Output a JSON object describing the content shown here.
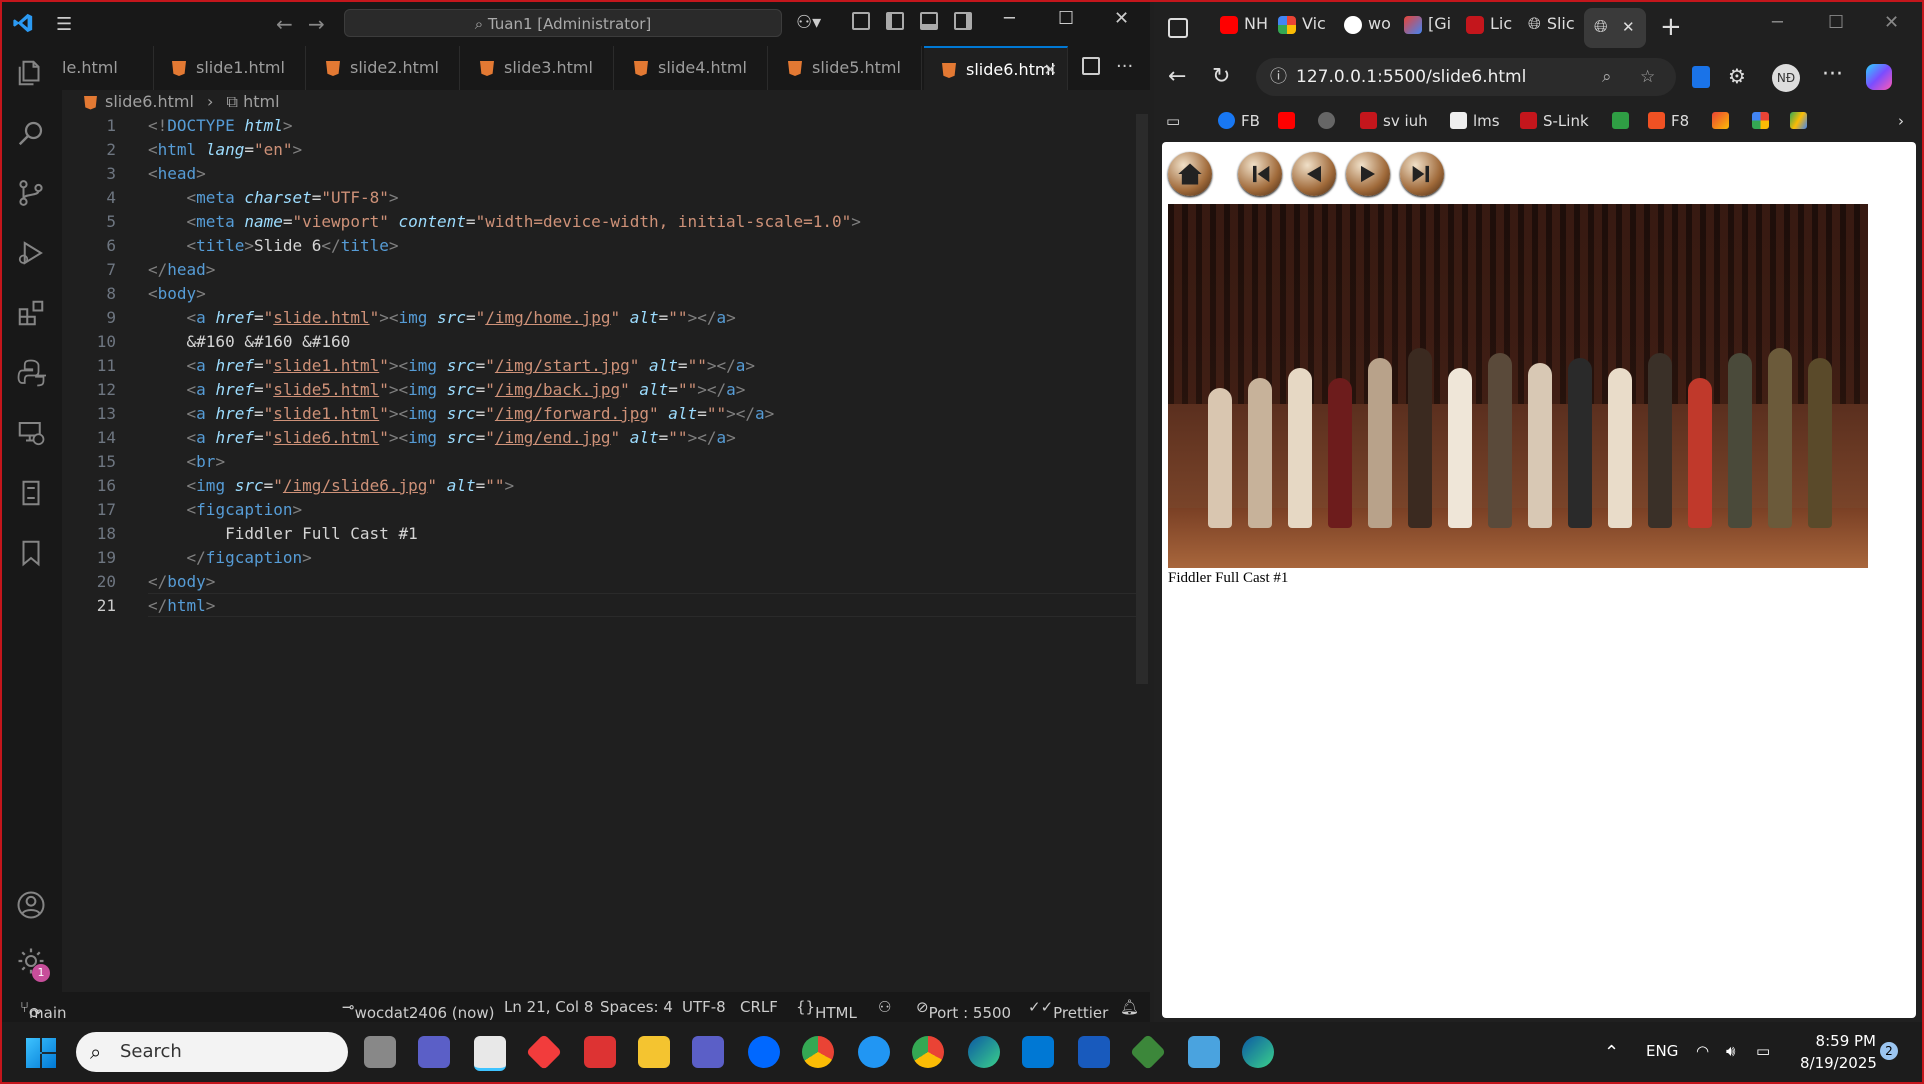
{
  "vscode": {
    "search_text": "Tuan1 [Administrator]",
    "tabs": [
      "le.html",
      "slide1.html",
      "slide2.html",
      "slide3.html",
      "slide4.html",
      "slide5.html",
      "slide6.html"
    ],
    "active_tab": "slide6.html",
    "breadcrumb_file": "slide6.html",
    "breadcrumb_symbol": "html",
    "line_numbers": [
      "1",
      "2",
      "3",
      "4",
      "5",
      "6",
      "7",
      "8",
      "9",
      "10",
      "11",
      "12",
      "13",
      "14",
      "15",
      "16",
      "17",
      "18",
      "19",
      "20",
      "21"
    ],
    "code": {
      "caption_text": "Fiddler Full Cast #1",
      "entities": "&#160 &#160 &#160",
      "title": "Slide 6"
    },
    "status": {
      "branch": "main",
      "author": "wocdat2406 (now)",
      "position": "Ln 21, Col 8",
      "spaces": "Spaces: 4",
      "encoding": "UTF-8",
      "eol": "CRLF",
      "language": "HTML",
      "port": "Port : 5500",
      "formatter": "Prettier"
    },
    "settings_badge": "1"
  },
  "browser": {
    "tabs": [
      "NH",
      "Vic",
      "wo",
      "[Gi",
      "Lic",
      "Slic"
    ],
    "url": "127.0.0.1:5500/slide6.html",
    "profile": "NĐ",
    "bookmarks": [
      "FB",
      "sv iuh",
      "lms",
      "S-Link",
      "F8"
    ],
    "page_caption": "Fiddler Full Cast #1"
  },
  "taskbar": {
    "search_placeholder": "Search",
    "lang": "ENG",
    "time": "8:59 PM",
    "date": "8/19/2025",
    "notif_count": "2"
  },
  "colors": {
    "accent": "#0078d4",
    "html_icon": "#e37933",
    "frame": "#c4161c"
  }
}
